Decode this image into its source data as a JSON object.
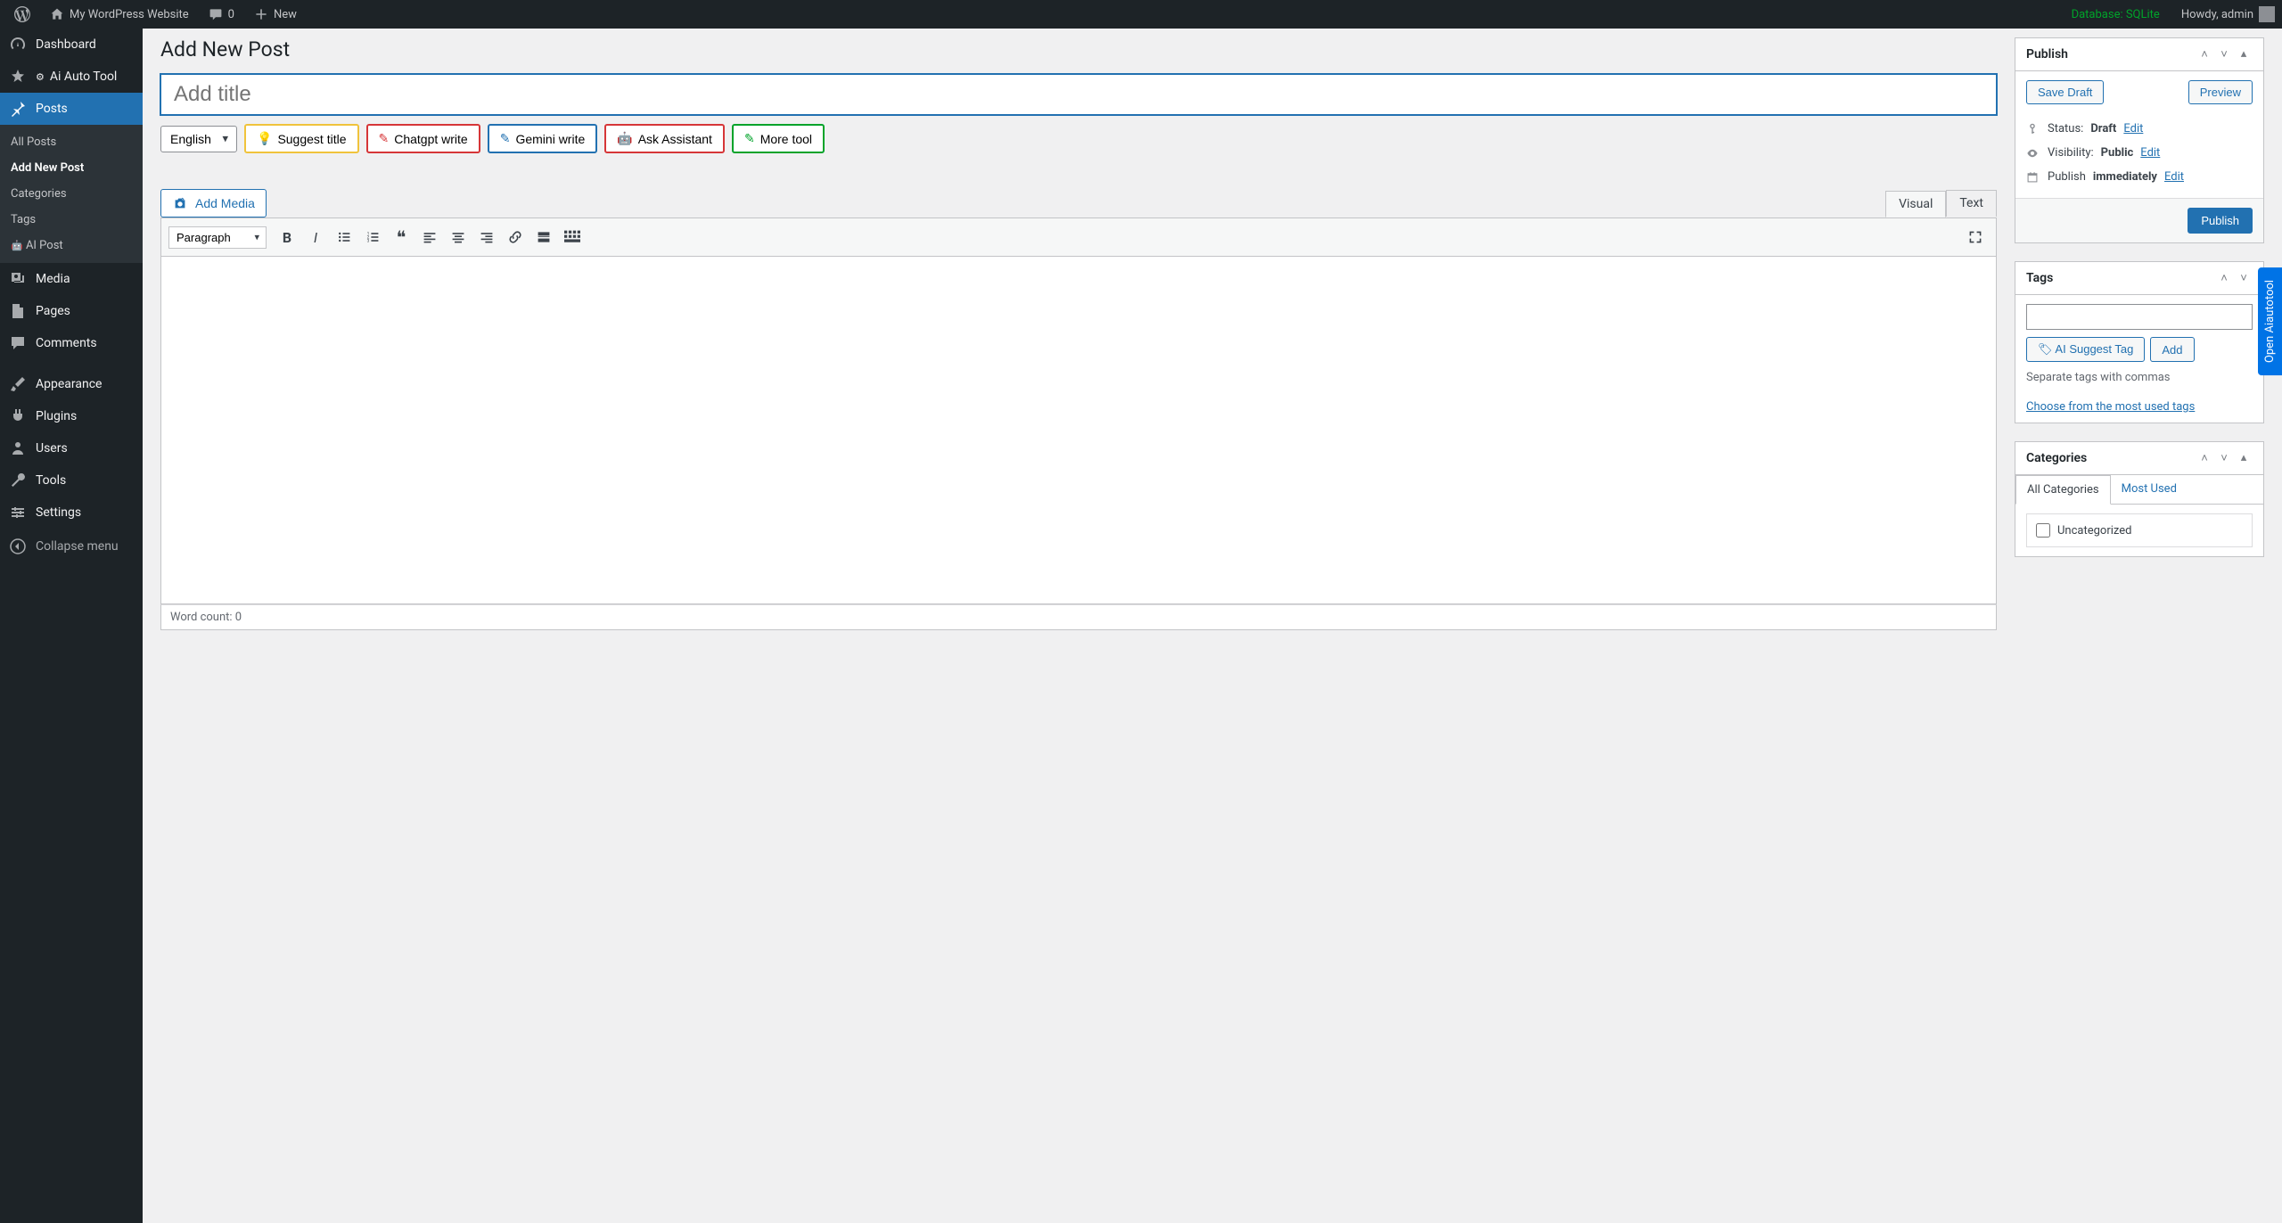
{
  "adminbar": {
    "site_name": "My WordPress Website",
    "comments_count": "0",
    "new_label": "New",
    "database_label": "Database: SQLite",
    "howdy": "Howdy, admin"
  },
  "sidebar": {
    "items": [
      {
        "label": "Dashboard"
      },
      {
        "label": "Ai Auto Tool"
      },
      {
        "label": "Posts"
      },
      {
        "label": "Media"
      },
      {
        "label": "Pages"
      },
      {
        "label": "Comments"
      },
      {
        "label": "Appearance"
      },
      {
        "label": "Plugins"
      },
      {
        "label": "Users"
      },
      {
        "label": "Tools"
      },
      {
        "label": "Settings"
      }
    ],
    "posts_submenu": [
      {
        "label": "All Posts"
      },
      {
        "label": "Add New Post"
      },
      {
        "label": "Categories"
      },
      {
        "label": "Tags"
      },
      {
        "label": "AI Post"
      }
    ],
    "collapse_label": "Collapse menu"
  },
  "page": {
    "title": "Add New Post",
    "title_placeholder": "Add title"
  },
  "ai_row": {
    "language": "English",
    "suggest_title": "Suggest title",
    "chatgpt_write": "Chatgpt write",
    "gemini_write": "Gemini write",
    "ask_assistant": "Ask Assistant",
    "more_tool": "More tool"
  },
  "editor": {
    "add_media": "Add Media",
    "tab_visual": "Visual",
    "tab_text": "Text",
    "paragraph": "Paragraph",
    "word_count_label": "Word count: 0"
  },
  "publish": {
    "heading": "Publish",
    "save_draft": "Save Draft",
    "preview": "Preview",
    "status_label": "Status:",
    "status_value": "Draft",
    "visibility_label": "Visibility:",
    "visibility_value": "Public",
    "publish_label": "Publish",
    "publish_value": "immediately",
    "edit": "Edit",
    "publish_button": "Publish"
  },
  "tags": {
    "heading": "Tags",
    "ai_suggest": "AI Suggest Tag",
    "add": "Add",
    "hint": "Separate tags with commas",
    "choose_most_used": "Choose from the most used tags"
  },
  "categories": {
    "heading": "Categories",
    "tab_all": "All Categories",
    "tab_most_used": "Most Used",
    "uncategorized": "Uncategorized"
  },
  "floating_tab": "Open Aiautotool"
}
